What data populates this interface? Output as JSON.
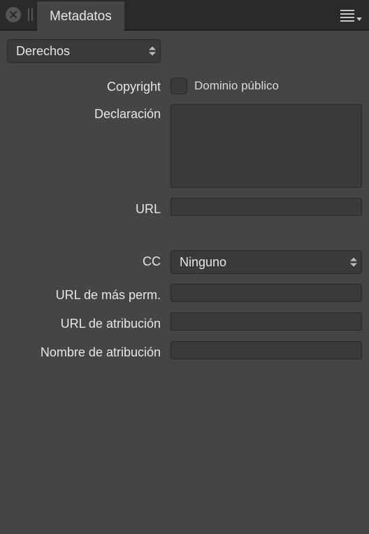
{
  "titlebar": {
    "tab_label": "Metadatos"
  },
  "section_select": {
    "value": "Derechos"
  },
  "fields": {
    "copyright": {
      "label": "Copyright",
      "checkbox_label": "Dominio público",
      "checked": false
    },
    "declaration": {
      "label": "Declaración",
      "value": ""
    },
    "url": {
      "label": "URL",
      "value": ""
    },
    "cc": {
      "label": "CC",
      "value": "Ninguno"
    },
    "more_perm_url": {
      "label": "URL de más perm.",
      "value": ""
    },
    "attrib_url": {
      "label": "URL de atribución",
      "value": ""
    },
    "attrib_name": {
      "label": "Nombre de atribución",
      "value": ""
    }
  }
}
